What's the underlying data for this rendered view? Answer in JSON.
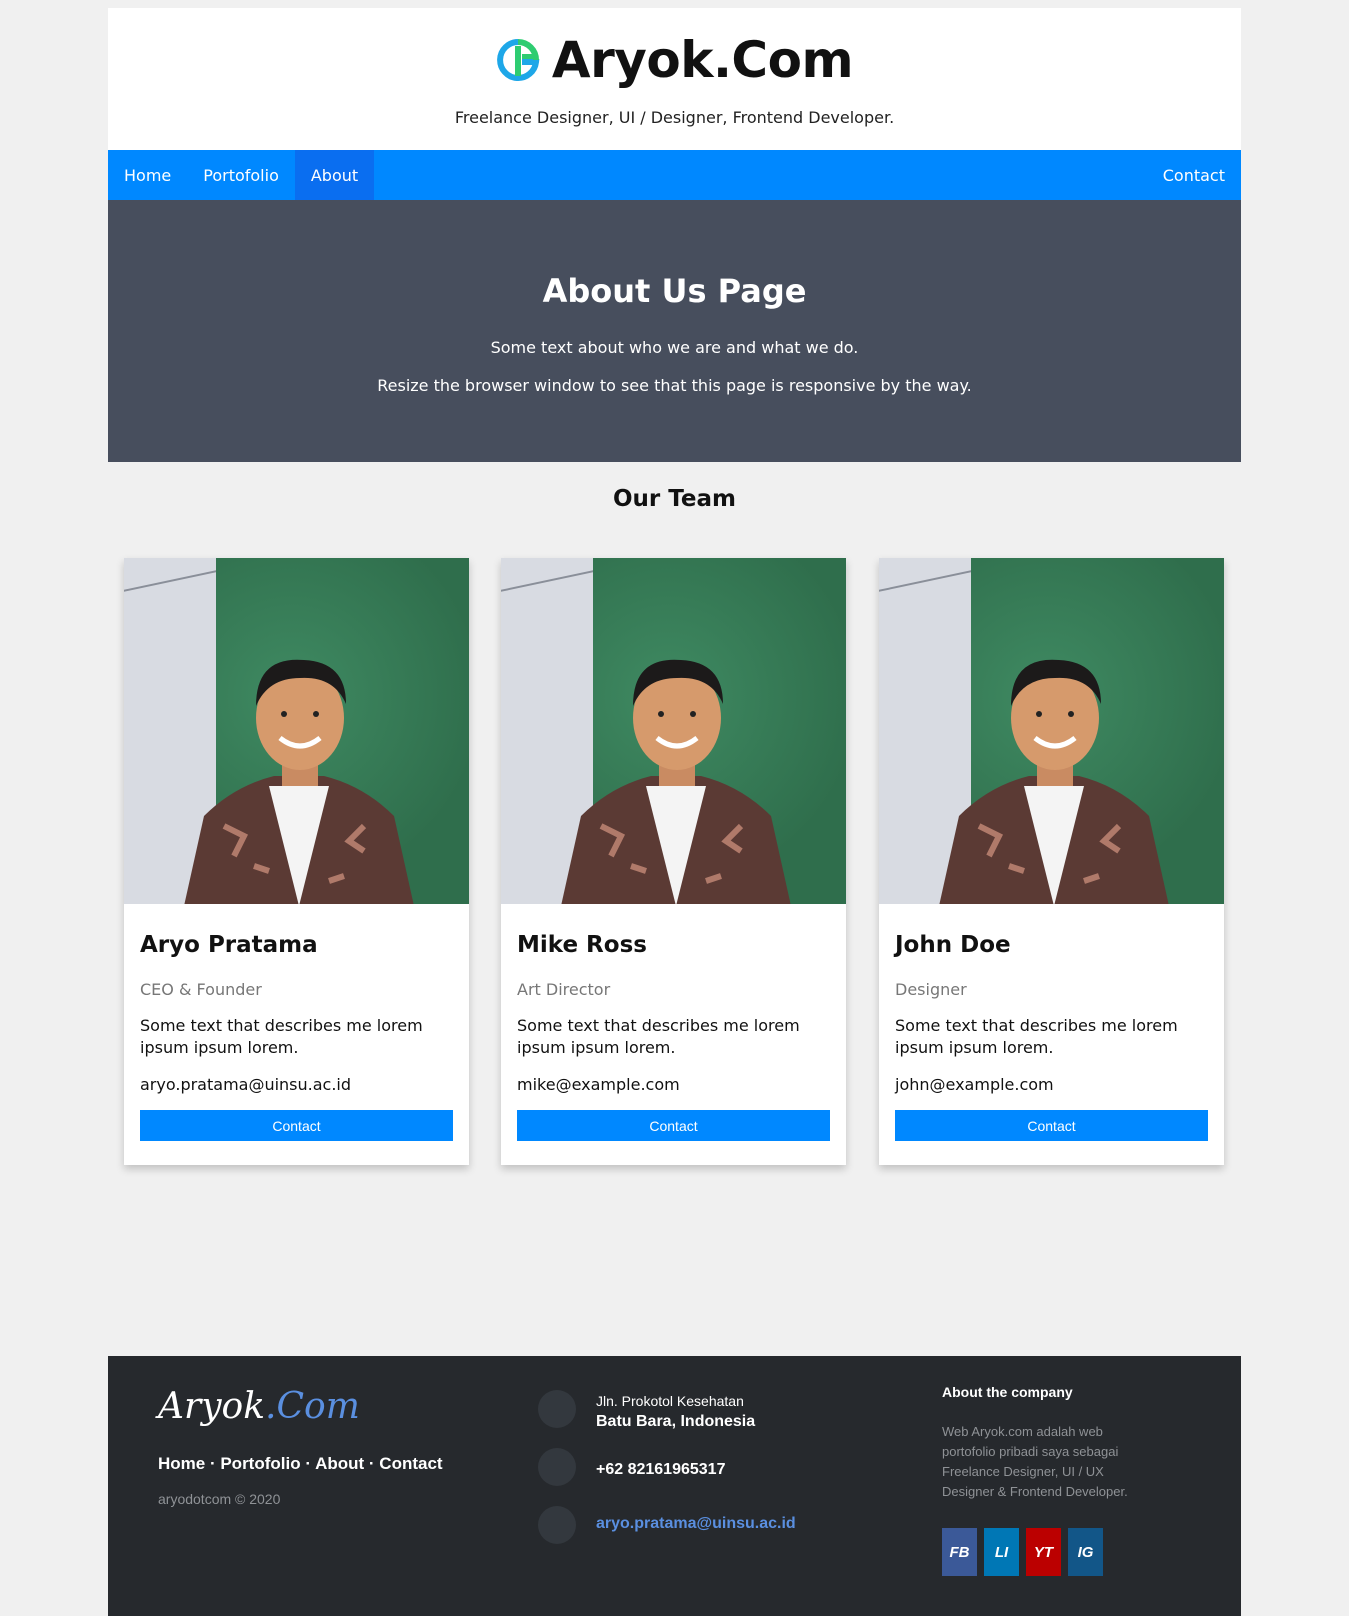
{
  "header": {
    "site_title": "Aryok.Com",
    "tagline": "Freelance Designer, UI / Designer, Frontend Developer."
  },
  "nav": {
    "items": [
      {
        "label": "Home"
      },
      {
        "label": "Portofolio"
      },
      {
        "label": "About",
        "active": true
      }
    ],
    "right_item": "Contact"
  },
  "hero": {
    "title": "About Us Page",
    "line1": "Some text about who we are and what we do.",
    "line2": "Resize the browser window to see that this page is responsive by the way."
  },
  "team": {
    "title": "Our Team",
    "members": [
      {
        "name": "Aryo Pratama",
        "role": "CEO & Founder",
        "desc": "Some text that describes me lorem ipsum ipsum lorem.",
        "email": "aryo.pratama@uinsu.ac.id",
        "button": "Contact"
      },
      {
        "name": "Mike Ross",
        "role": "Art Director",
        "desc": "Some text that describes me lorem ipsum ipsum lorem.",
        "email": "mike@example.com",
        "button": "Contact"
      },
      {
        "name": "John Doe",
        "role": "Designer",
        "desc": "Some text that describes me lorem ipsum ipsum lorem.",
        "email": "john@example.com",
        "button": "Contact"
      }
    ]
  },
  "footer": {
    "logo_main": "Aryok",
    "logo_accent": ".Com",
    "links": [
      "Home",
      "Portofolio",
      "About",
      "Contact"
    ],
    "separator": " · ",
    "copyright": "aryodotcom © 2020",
    "address_line1": "Jln. Prokotol Kesehatan",
    "address_line2": "Batu Bara, Indonesia",
    "phone": "+62 82161965317",
    "email": "aryo.pratama@uinsu.ac.id",
    "about_title": "About the company",
    "about_text": "Web Aryok.com adalah web portofolio pribadi saya sebagai Freelance Designer, UI / UX Designer & Frontend Developer.",
    "socials": [
      {
        "label": "FB",
        "color": "#3b5998"
      },
      {
        "label": "LI",
        "color": "#0077b5"
      },
      {
        "label": "YT",
        "color": "#bb0000"
      },
      {
        "label": "IG",
        "color": "#125688"
      }
    ]
  },
  "colors": {
    "nav": "#0088ff",
    "nav_active": "#0a6ef0",
    "hero": "#474e5d",
    "footer": "#26292d",
    "footer_accent": "#5a8fe0"
  }
}
